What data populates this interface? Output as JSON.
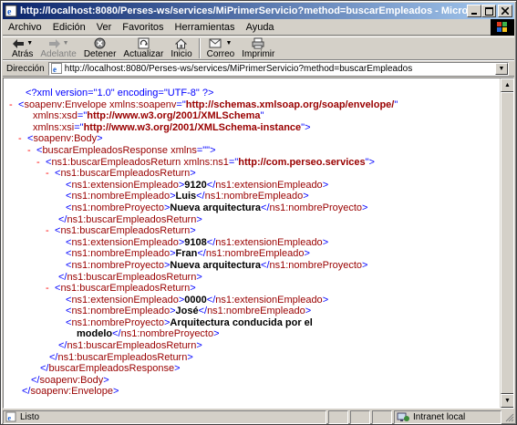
{
  "window": {
    "title": "http://localhost:8080/Perses-ws/services/MiPrimerServicio?method=buscarEmpleados - Microsoft Internet Explorer"
  },
  "menu": [
    "Archivo",
    "Edición",
    "Ver",
    "Favoritos",
    "Herramientas",
    "Ayuda"
  ],
  "toolbar": {
    "back": "Atrás",
    "forward": "Adelante",
    "stop": "Detener",
    "refresh": "Actualizar",
    "home": "Inicio",
    "mail": "Correo",
    "print": "Imprimir"
  },
  "address": {
    "label": "Dirección",
    "url": "http://localhost:8080/Perses-ws/services/MiPrimerServicio?method=buscarEmpleados"
  },
  "xml": {
    "decl": "<?xml version=\"1.0\" encoding=\"UTF-8\" ?>",
    "env_open": "soapenv:Envelope",
    "env_ns_attr": "xmlns:soapenv",
    "env_ns_val": "http://schemas.xmlsoap.org/soap/envelope/",
    "xsd_attr": "xmlns:xsd",
    "xsd_val": "http://www.w3.org/2001/XMLSchema",
    "xsi_attr": "xmlns:xsi",
    "xsi_val": "http://www.w3.org/2001/XMLSchema-instance",
    "body": "soapenv:Body",
    "resp": "buscarEmpleadosResponse",
    "resp_attr": "xmlns",
    "resp_val": "",
    "ret_outer": "ns1:buscarEmpleadosReturn",
    "ret_outer_attr": "xmlns:ns1",
    "ret_outer_val": "http://com.perseo.services",
    "ret_inner": "ns1:buscarEmpleadosReturn",
    "ext_tag": "ns1:extensionEmpleado",
    "nom_tag": "ns1:nombreEmpleado",
    "proy_tag": "ns1:nombreProyecto",
    "proy_close_tag": "ns1:nombreProyecto",
    "records": [
      {
        "ext": "9120",
        "nombre": "Luis",
        "proyecto": "Nueva arquitectura"
      },
      {
        "ext": "9108",
        "nombre": "Fran",
        "proyecto": "Nueva arquitectura"
      },
      {
        "ext": "0000",
        "nombre": "José",
        "proyecto_a": "Arquitectura conducida por el",
        "proyecto_b": "modelo"
      }
    ]
  },
  "status": {
    "text": "Listo",
    "zone": "Intranet local"
  }
}
